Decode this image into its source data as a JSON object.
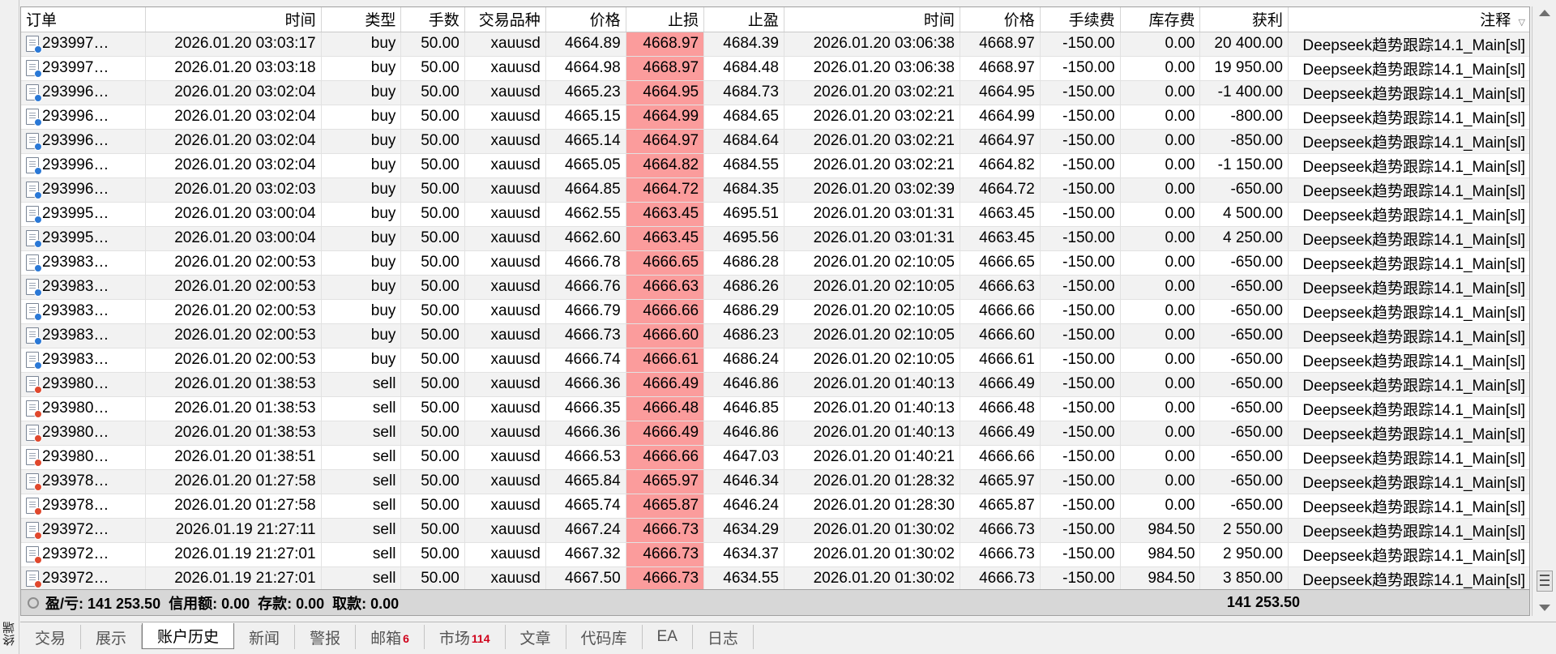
{
  "terminal": {
    "side_label": "终端"
  },
  "columns": [
    "订单",
    "时间",
    "类型",
    "手数",
    "交易品种",
    "价格",
    "止损",
    "止盈",
    "时间",
    "价格",
    "手续费",
    "库存费",
    "获利",
    "注释"
  ],
  "sort_indicator_icon": "sort-arrow-icon",
  "colors": {
    "sl_highlight": "#fb9c9c",
    "buy_dot": "#2a78d6",
    "sell_dot": "#e0482d",
    "badge": "#d0021b"
  },
  "rows": [
    {
      "order": "293997…",
      "open_time": "2026.01.20 03:03:17",
      "type": "buy",
      "volume": "50.00",
      "symbol": "xauusd",
      "open_price": "4664.89",
      "sl": "4668.97",
      "tp": "4684.39",
      "close_time": "2026.01.20 03:06:38",
      "close_price": "4668.97",
      "commission": "-150.00",
      "swap": "0.00",
      "profit": "20 400.00",
      "comment": "Deepseek趋势跟踪14.1_Main[sl]"
    },
    {
      "order": "293997…",
      "open_time": "2026.01.20 03:03:18",
      "type": "buy",
      "volume": "50.00",
      "symbol": "xauusd",
      "open_price": "4664.98",
      "sl": "4668.97",
      "tp": "4684.48",
      "close_time": "2026.01.20 03:06:38",
      "close_price": "4668.97",
      "commission": "-150.00",
      "swap": "0.00",
      "profit": "19 950.00",
      "comment": "Deepseek趋势跟踪14.1_Main[sl]"
    },
    {
      "order": "293996…",
      "open_time": "2026.01.20 03:02:04",
      "type": "buy",
      "volume": "50.00",
      "symbol": "xauusd",
      "open_price": "4665.23",
      "sl": "4664.95",
      "tp": "4684.73",
      "close_time": "2026.01.20 03:02:21",
      "close_price": "4664.95",
      "commission": "-150.00",
      "swap": "0.00",
      "profit": "-1 400.00",
      "comment": "Deepseek趋势跟踪14.1_Main[sl]"
    },
    {
      "order": "293996…",
      "open_time": "2026.01.20 03:02:04",
      "type": "buy",
      "volume": "50.00",
      "symbol": "xauusd",
      "open_price": "4665.15",
      "sl": "4664.99",
      "tp": "4684.65",
      "close_time": "2026.01.20 03:02:21",
      "close_price": "4664.99",
      "commission": "-150.00",
      "swap": "0.00",
      "profit": "-800.00",
      "comment": "Deepseek趋势跟踪14.1_Main[sl]"
    },
    {
      "order": "293996…",
      "open_time": "2026.01.20 03:02:04",
      "type": "buy",
      "volume": "50.00",
      "symbol": "xauusd",
      "open_price": "4665.14",
      "sl": "4664.97",
      "tp": "4684.64",
      "close_time": "2026.01.20 03:02:21",
      "close_price": "4664.97",
      "commission": "-150.00",
      "swap": "0.00",
      "profit": "-850.00",
      "comment": "Deepseek趋势跟踪14.1_Main[sl]"
    },
    {
      "order": "293996…",
      "open_time": "2026.01.20 03:02:04",
      "type": "buy",
      "volume": "50.00",
      "symbol": "xauusd",
      "open_price": "4665.05",
      "sl": "4664.82",
      "tp": "4684.55",
      "close_time": "2026.01.20 03:02:21",
      "close_price": "4664.82",
      "commission": "-150.00",
      "swap": "0.00",
      "profit": "-1 150.00",
      "comment": "Deepseek趋势跟踪14.1_Main[sl]"
    },
    {
      "order": "293996…",
      "open_time": "2026.01.20 03:02:03",
      "type": "buy",
      "volume": "50.00",
      "symbol": "xauusd",
      "open_price": "4664.85",
      "sl": "4664.72",
      "tp": "4684.35",
      "close_time": "2026.01.20 03:02:39",
      "close_price": "4664.72",
      "commission": "-150.00",
      "swap": "0.00",
      "profit": "-650.00",
      "comment": "Deepseek趋势跟踪14.1_Main[sl]"
    },
    {
      "order": "293995…",
      "open_time": "2026.01.20 03:00:04",
      "type": "buy",
      "volume": "50.00",
      "symbol": "xauusd",
      "open_price": "4662.55",
      "sl": "4663.45",
      "tp": "4695.51",
      "close_time": "2026.01.20 03:01:31",
      "close_price": "4663.45",
      "commission": "-150.00",
      "swap": "0.00",
      "profit": "4 500.00",
      "comment": "Deepseek趋势跟踪14.1_Main[sl]"
    },
    {
      "order": "293995…",
      "open_time": "2026.01.20 03:00:04",
      "type": "buy",
      "volume": "50.00",
      "symbol": "xauusd",
      "open_price": "4662.60",
      "sl": "4663.45",
      "tp": "4695.56",
      "close_time": "2026.01.20 03:01:31",
      "close_price": "4663.45",
      "commission": "-150.00",
      "swap": "0.00",
      "profit": "4 250.00",
      "comment": "Deepseek趋势跟踪14.1_Main[sl]"
    },
    {
      "order": "293983…",
      "open_time": "2026.01.20 02:00:53",
      "type": "buy",
      "volume": "50.00",
      "symbol": "xauusd",
      "open_price": "4666.78",
      "sl": "4666.65",
      "tp": "4686.28",
      "close_time": "2026.01.20 02:10:05",
      "close_price": "4666.65",
      "commission": "-150.00",
      "swap": "0.00",
      "profit": "-650.00",
      "comment": "Deepseek趋势跟踪14.1_Main[sl]"
    },
    {
      "order": "293983…",
      "open_time": "2026.01.20 02:00:53",
      "type": "buy",
      "volume": "50.00",
      "symbol": "xauusd",
      "open_price": "4666.76",
      "sl": "4666.63",
      "tp": "4686.26",
      "close_time": "2026.01.20 02:10:05",
      "close_price": "4666.63",
      "commission": "-150.00",
      "swap": "0.00",
      "profit": "-650.00",
      "comment": "Deepseek趋势跟踪14.1_Main[sl]"
    },
    {
      "order": "293983…",
      "open_time": "2026.01.20 02:00:53",
      "type": "buy",
      "volume": "50.00",
      "symbol": "xauusd",
      "open_price": "4666.79",
      "sl": "4666.66",
      "tp": "4686.29",
      "close_time": "2026.01.20 02:10:05",
      "close_price": "4666.66",
      "commission": "-150.00",
      "swap": "0.00",
      "profit": "-650.00",
      "comment": "Deepseek趋势跟踪14.1_Main[sl]"
    },
    {
      "order": "293983…",
      "open_time": "2026.01.20 02:00:53",
      "type": "buy",
      "volume": "50.00",
      "symbol": "xauusd",
      "open_price": "4666.73",
      "sl": "4666.60",
      "tp": "4686.23",
      "close_time": "2026.01.20 02:10:05",
      "close_price": "4666.60",
      "commission": "-150.00",
      "swap": "0.00",
      "profit": "-650.00",
      "comment": "Deepseek趋势跟踪14.1_Main[sl]"
    },
    {
      "order": "293983…",
      "open_time": "2026.01.20 02:00:53",
      "type": "buy",
      "volume": "50.00",
      "symbol": "xauusd",
      "open_price": "4666.74",
      "sl": "4666.61",
      "tp": "4686.24",
      "close_time": "2026.01.20 02:10:05",
      "close_price": "4666.61",
      "commission": "-150.00",
      "swap": "0.00",
      "profit": "-650.00",
      "comment": "Deepseek趋势跟踪14.1_Main[sl]"
    },
    {
      "order": "293980…",
      "open_time": "2026.01.20 01:38:53",
      "type": "sell",
      "volume": "50.00",
      "symbol": "xauusd",
      "open_price": "4666.36",
      "sl": "4666.49",
      "tp": "4646.86",
      "close_time": "2026.01.20 01:40:13",
      "close_price": "4666.49",
      "commission": "-150.00",
      "swap": "0.00",
      "profit": "-650.00",
      "comment": "Deepseek趋势跟踪14.1_Main[sl]"
    },
    {
      "order": "293980…",
      "open_time": "2026.01.20 01:38:53",
      "type": "sell",
      "volume": "50.00",
      "symbol": "xauusd",
      "open_price": "4666.35",
      "sl": "4666.48",
      "tp": "4646.85",
      "close_time": "2026.01.20 01:40:13",
      "close_price": "4666.48",
      "commission": "-150.00",
      "swap": "0.00",
      "profit": "-650.00",
      "comment": "Deepseek趋势跟踪14.1_Main[sl]"
    },
    {
      "order": "293980…",
      "open_time": "2026.01.20 01:38:53",
      "type": "sell",
      "volume": "50.00",
      "symbol": "xauusd",
      "open_price": "4666.36",
      "sl": "4666.49",
      "tp": "4646.86",
      "close_time": "2026.01.20 01:40:13",
      "close_price": "4666.49",
      "commission": "-150.00",
      "swap": "0.00",
      "profit": "-650.00",
      "comment": "Deepseek趋势跟踪14.1_Main[sl]"
    },
    {
      "order": "293980…",
      "open_time": "2026.01.20 01:38:51",
      "type": "sell",
      "volume": "50.00",
      "symbol": "xauusd",
      "open_price": "4666.53",
      "sl": "4666.66",
      "tp": "4647.03",
      "close_time": "2026.01.20 01:40:21",
      "close_price": "4666.66",
      "commission": "-150.00",
      "swap": "0.00",
      "profit": "-650.00",
      "comment": "Deepseek趋势跟踪14.1_Main[sl]"
    },
    {
      "order": "293978…",
      "open_time": "2026.01.20 01:27:58",
      "type": "sell",
      "volume": "50.00",
      "symbol": "xauusd",
      "open_price": "4665.84",
      "sl": "4665.97",
      "tp": "4646.34",
      "close_time": "2026.01.20 01:28:32",
      "close_price": "4665.97",
      "commission": "-150.00",
      "swap": "0.00",
      "profit": "-650.00",
      "comment": "Deepseek趋势跟踪14.1_Main[sl]"
    },
    {
      "order": "293978…",
      "open_time": "2026.01.20 01:27:58",
      "type": "sell",
      "volume": "50.00",
      "symbol": "xauusd",
      "open_price": "4665.74",
      "sl": "4665.87",
      "tp": "4646.24",
      "close_time": "2026.01.20 01:28:30",
      "close_price": "4665.87",
      "commission": "-150.00",
      "swap": "0.00",
      "profit": "-650.00",
      "comment": "Deepseek趋势跟踪14.1_Main[sl]"
    },
    {
      "order": "293972…",
      "open_time": "2026.01.19 21:27:11",
      "type": "sell",
      "volume": "50.00",
      "symbol": "xauusd",
      "open_price": "4667.24",
      "sl": "4666.73",
      "tp": "4634.29",
      "close_time": "2026.01.20 01:30:02",
      "close_price": "4666.73",
      "commission": "-150.00",
      "swap": "984.50",
      "profit": "2 550.00",
      "comment": "Deepseek趋势跟踪14.1_Main[sl]"
    },
    {
      "order": "293972…",
      "open_time": "2026.01.19 21:27:01",
      "type": "sell",
      "volume": "50.00",
      "symbol": "xauusd",
      "open_price": "4667.32",
      "sl": "4666.73",
      "tp": "4634.37",
      "close_time": "2026.01.20 01:30:02",
      "close_price": "4666.73",
      "commission": "-150.00",
      "swap": "984.50",
      "profit": "2 950.00",
      "comment": "Deepseek趋势跟踪14.1_Main[sl]"
    },
    {
      "order": "293972…",
      "open_time": "2026.01.19 21:27:01",
      "type": "sell",
      "volume": "50.00",
      "symbol": "xauusd",
      "open_price": "4667.50",
      "sl": "4666.73",
      "tp": "4634.55",
      "close_time": "2026.01.20 01:30:02",
      "close_price": "4666.73",
      "commission": "-150.00",
      "swap": "984.50",
      "profit": "3 850.00",
      "comment": "Deepseek趋势跟踪14.1_Main[sl]"
    }
  ],
  "summary": {
    "text": "盈/亏: 141 253.50  信用额: 0.00  存款: 0.00  取款: 0.00",
    "total_profit": "141 253.50"
  },
  "tabs": [
    {
      "label": "交易",
      "active": false,
      "count": ""
    },
    {
      "label": "展示",
      "active": false,
      "count": ""
    },
    {
      "label": "账户历史",
      "active": true,
      "count": ""
    },
    {
      "label": "新闻",
      "active": false,
      "count": ""
    },
    {
      "label": "警报",
      "active": false,
      "count": ""
    },
    {
      "label": "邮箱",
      "active": false,
      "count": "6"
    },
    {
      "label": "市场",
      "active": false,
      "count": "114"
    },
    {
      "label": "文章",
      "active": false,
      "count": ""
    },
    {
      "label": "代码库",
      "active": false,
      "count": ""
    },
    {
      "label": "EA",
      "active": false,
      "count": ""
    },
    {
      "label": "日志",
      "active": false,
      "count": ""
    }
  ]
}
